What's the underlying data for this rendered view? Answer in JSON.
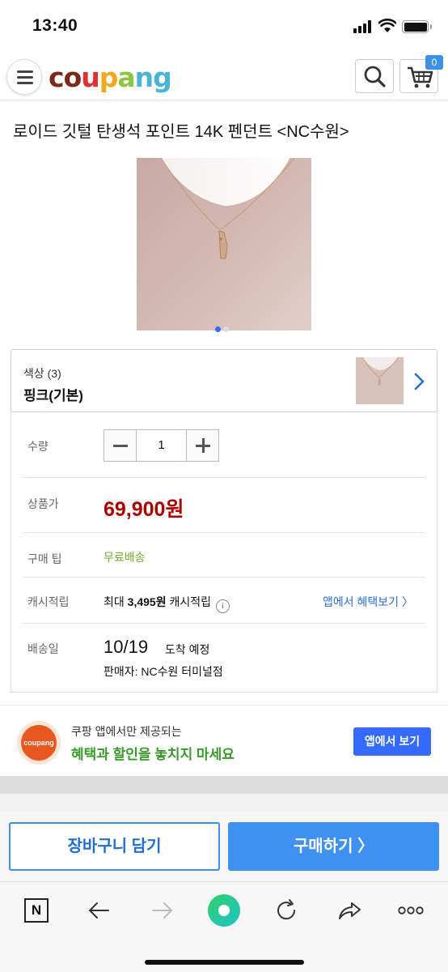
{
  "status_bar": {
    "time": "13:40"
  },
  "header": {
    "logo_letters": [
      {
        "ch": "c",
        "color": "#7a2a1b"
      },
      {
        "ch": "o",
        "color": "#7a2a1b"
      },
      {
        "ch": "u",
        "color": "#e0312c"
      },
      {
        "ch": "p",
        "color": "#f2a81d"
      },
      {
        "ch": "a",
        "color": "#8cc63e"
      },
      {
        "ch": "n",
        "color": "#4ab3d8"
      },
      {
        "ch": "g",
        "color": "#4ab3d8"
      }
    ],
    "cart_count": "0"
  },
  "product": {
    "title": "로이드 깃털 탄생석 포인트 14K 펜던트 <NC수원>",
    "image_count": 2,
    "current_image": 1
  },
  "option": {
    "label": "색상 (3)",
    "value": "핑크(기본)"
  },
  "details": {
    "quantity_label": "수량",
    "quantity_value": "1",
    "price_label": "상품가",
    "price": "69,900원",
    "tip_label": "구매 팁",
    "tip_value": "무료배송",
    "cash_label": "캐시적립",
    "cash_prefix": "최대",
    "cash_amount": "3,495원",
    "cash_suffix": "캐시적립",
    "info_symbol": "i",
    "cash_link": "앱에서 혜택보기 〉",
    "delivery_label": "배송일",
    "delivery_date": "10/19",
    "delivery_arrival": "도착 예정",
    "seller": "판매자: NC수원 터미널점"
  },
  "promo": {
    "logo_text": "coupang",
    "line1": "쿠팡 앱에서만 제공되는",
    "line2": "혜택과 할인을 놓치지 마세요",
    "button": "앱에서 보기"
  },
  "actions": {
    "add_to_cart": "장바구니 담기",
    "buy_now": "구매하기 〉"
  },
  "browser_bar": {
    "n_label": "N"
  },
  "colors": {
    "price_red": "#ae0000",
    "accent_blue": "#3e91ef",
    "green": "#3a9a2b"
  }
}
